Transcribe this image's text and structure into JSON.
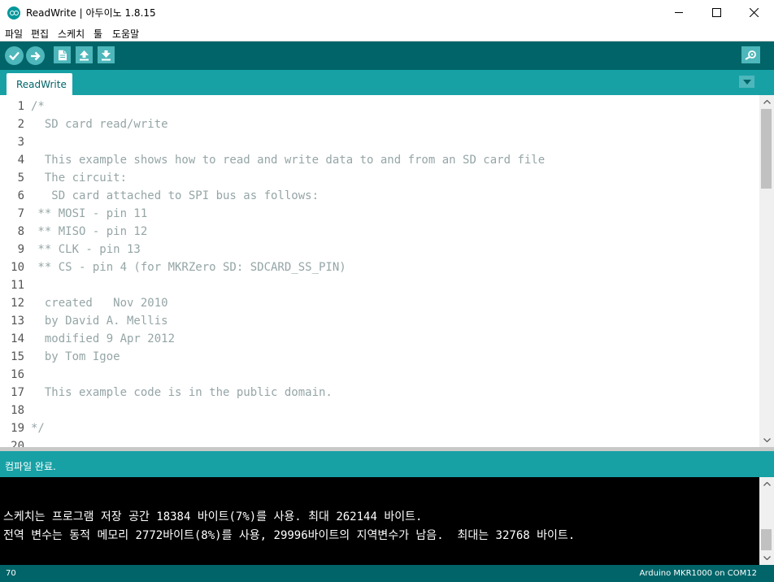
{
  "window": {
    "title": "ReadWrite | 아두이노 1.8.15"
  },
  "menu": {
    "items": [
      "파일",
      "편집",
      "스케치",
      "툴",
      "도움말"
    ]
  },
  "toolbar": {
    "buttons": [
      {
        "name": "verify",
        "icon": "check-icon"
      },
      {
        "name": "upload",
        "icon": "arrow-right-icon"
      },
      {
        "name": "new",
        "icon": "new-file-icon"
      },
      {
        "name": "open",
        "icon": "open-icon"
      },
      {
        "name": "save",
        "icon": "save-icon"
      },
      {
        "name": "serial-monitor",
        "icon": "magnifier-icon"
      }
    ],
    "accent_color": "#006468",
    "button_color": "#4db7bb"
  },
  "tabs": [
    {
      "label": "ReadWrite",
      "active": true
    }
  ],
  "editor": {
    "lines": [
      {
        "n": "1",
        "text": "/*"
      },
      {
        "n": "2",
        "text": "  SD card read/write"
      },
      {
        "n": "3",
        "text": ""
      },
      {
        "n": "4",
        "text": "  This example shows how to read and write data to and from an SD card file"
      },
      {
        "n": "5",
        "text": "  The circuit:"
      },
      {
        "n": "6",
        "text": "   SD card attached to SPI bus as follows:"
      },
      {
        "n": "7",
        "text": " ** MOSI - pin 11"
      },
      {
        "n": "8",
        "text": " ** MISO - pin 12"
      },
      {
        "n": "9",
        "text": " ** CLK - pin 13"
      },
      {
        "n": "10",
        "text": " ** CS - pin 4 (for MKRZero SD: SDCARD_SS_PIN)"
      },
      {
        "n": "11",
        "text": ""
      },
      {
        "n": "12",
        "text": "  created   Nov 2010"
      },
      {
        "n": "13",
        "text": "  by David A. Mellis"
      },
      {
        "n": "14",
        "text": "  modified 9 Apr 2012"
      },
      {
        "n": "15",
        "text": "  by Tom Igoe"
      },
      {
        "n": "16",
        "text": ""
      },
      {
        "n": "17",
        "text": "  This example code is in the public domain."
      },
      {
        "n": "18",
        "text": ""
      },
      {
        "n": "19",
        "text": "*/"
      },
      {
        "n": "20",
        "text": ""
      }
    ]
  },
  "status": {
    "message": "컴파일 완료."
  },
  "console": {
    "lines": [
      "스케치는 프로그램 저장 공간 18384 바이트(7%)를 사용. 최대 262144 바이트.",
      "전역 변수는 동적 메모리 2772바이트(8%)를 사용, 29996바이트의 지역변수가 남음.  최대는 32768 바이트."
    ]
  },
  "footer": {
    "line_number": "70",
    "board_port": "Arduino MKR1000 on COM12"
  }
}
